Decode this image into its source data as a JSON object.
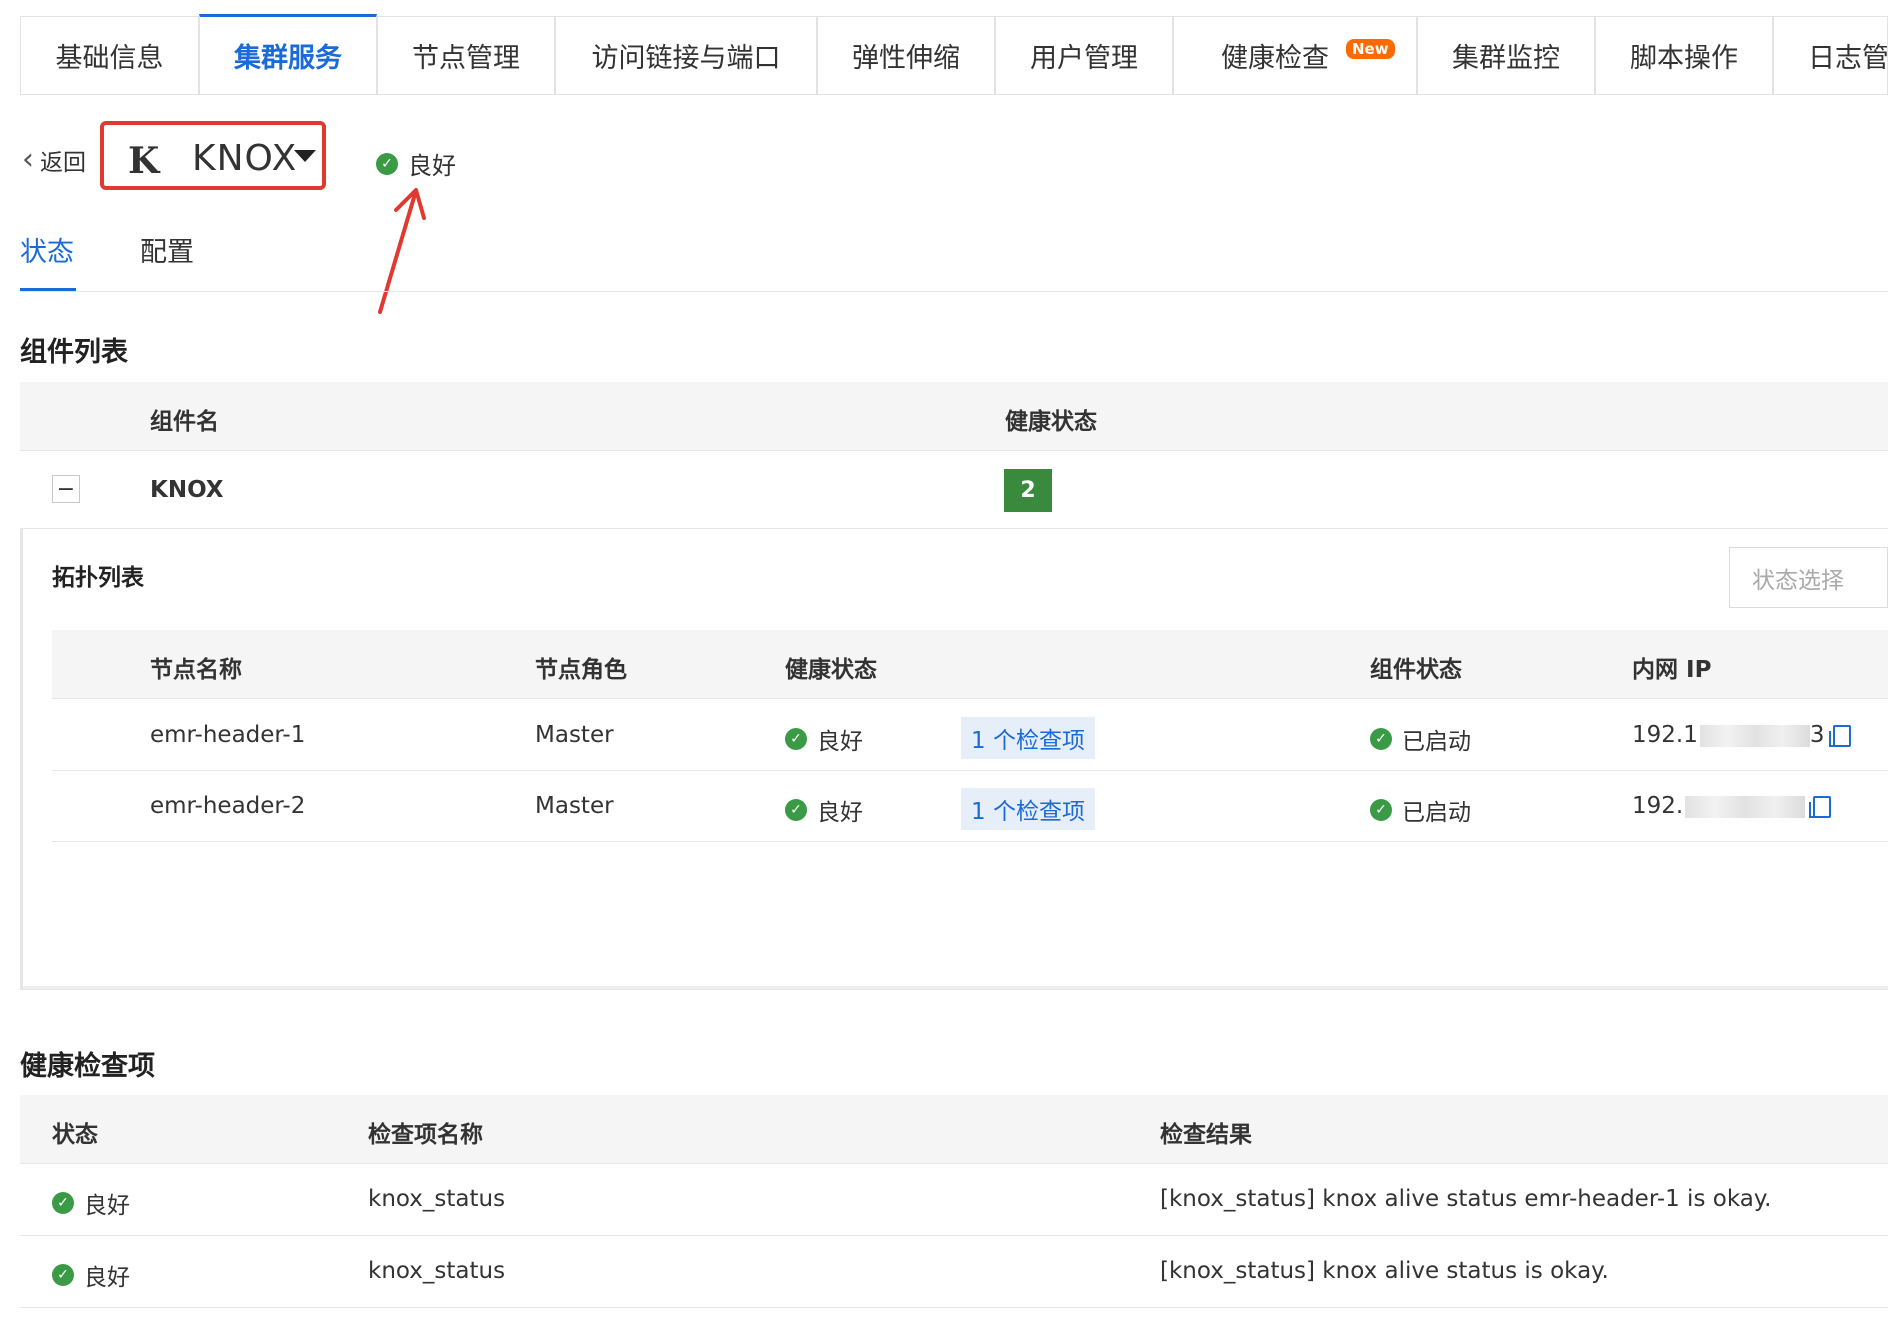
{
  "tabs": [
    {
      "label": "基础信息"
    },
    {
      "label": "集群服务"
    },
    {
      "label": "节点管理"
    },
    {
      "label": "访问链接与端口"
    },
    {
      "label": "弹性伸缩"
    },
    {
      "label": "用户管理"
    },
    {
      "label": "健康检查",
      "badge": "New"
    },
    {
      "label": "集群监控"
    },
    {
      "label": "脚本操作"
    },
    {
      "label": "日志管"
    }
  ],
  "active_tab": "集群服务",
  "header": {
    "back_label": "返回",
    "service_logo": "K",
    "service_name": "KNOX",
    "status": "良好"
  },
  "subtabs": [
    {
      "label": "状态"
    },
    {
      "label": "配置"
    }
  ],
  "components": {
    "title": "组件列表",
    "columns": [
      "组件名",
      "健康状态"
    ],
    "rows": [
      {
        "name": "KNOX",
        "count": "2",
        "expand": "−"
      }
    ]
  },
  "topology": {
    "title": "拓扑列表",
    "state_select_placeholder": "状态选择",
    "columns": [
      "节点名称",
      "节点角色",
      "健康状态",
      "组件状态",
      "内网 IP"
    ],
    "rows": [
      {
        "node": "emr-header-1",
        "role": "Master",
        "health": "良好",
        "checks": "1 个检查项",
        "comp_status": "已启动",
        "ip_prefix": "192.1",
        "ip_suffix": "3"
      },
      {
        "node": "emr-header-2",
        "role": "Master",
        "health": "良好",
        "checks": "1 个检查项",
        "comp_status": "已启动",
        "ip_prefix": "192.",
        "ip_suffix": ""
      }
    ]
  },
  "health_checks": {
    "title": "健康检查项",
    "columns": [
      "状态",
      "检查项名称",
      "检查结果"
    ],
    "rows": [
      {
        "status": "良好",
        "name": "knox_status",
        "result": "[knox_status] knox alive status emr-header-1 is okay."
      },
      {
        "status": "良好",
        "name": "knox_status",
        "result": "[knox_status] knox alive status is okay."
      }
    ]
  },
  "colors": {
    "accent": "#1a6ad8",
    "ok": "#3a9a46",
    "highlight": "#e03a30",
    "badge_new": "#ff6a00"
  }
}
